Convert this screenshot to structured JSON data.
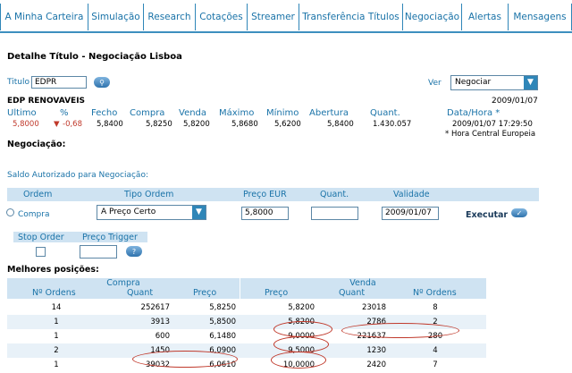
{
  "nav": [
    "A Minha Carteira",
    "Simulação",
    "Research",
    "Cotações",
    "Streamer",
    "Transferência Títulos",
    "Negociação",
    "Alertas",
    "Mensagens"
  ],
  "page_title": "Detalhe Título - Negociação Lisboa",
  "titulo": {
    "label": "Titulo",
    "value": "EDPR"
  },
  "ver": {
    "label": "Ver",
    "value": "Negociar"
  },
  "quote": {
    "name": "EDP RENOVAVEIS",
    "date": "2009/01/07",
    "headers": [
      "Ultimo",
      "%",
      "Fecho",
      "Compra",
      "Venda",
      "Máximo",
      "Mínimo",
      "Abertura",
      "Quant.",
      "Data/Hora *"
    ],
    "values": [
      "5,8000",
      "-0,68",
      "5,8400",
      "5,8250",
      "5,8200",
      "5,8680",
      "5,6200",
      "5,8400",
      "1.430.057",
      "2009/01/07 17:29:50"
    ],
    "note": "* Hora Central Europeia",
    "down_color": "#c0392b"
  },
  "negociacao_label": "Negociação:",
  "saldo_label": "Saldo Autorizado para Negociação:",
  "order": {
    "headers": [
      "Ordem",
      "Tipo Ordem",
      "Preço EUR",
      "Quant.",
      "Validade"
    ],
    "side": "Compra",
    "tipo": "A Preço Certo",
    "preco": "5,8000",
    "quant": "",
    "validade": "2009/01/07",
    "executar": "Executar"
  },
  "stop": {
    "headers": [
      "Stop Order",
      "Preço Trigger"
    ],
    "trigger": ""
  },
  "book": {
    "title": "Melhores posições:",
    "group_compra": "Compra",
    "group_venda": "Venda",
    "headers": [
      "Nº Ordens",
      "Quant",
      "Preço",
      "Preço",
      "Quant",
      "Nº Ordens"
    ],
    "rows": [
      [
        "14",
        "252617",
        "5,8250",
        "5,8200",
        "23018",
        "8"
      ],
      [
        "1",
        "3913",
        "5,8500",
        "5,8200",
        "2786",
        "2"
      ],
      [
        "1",
        "600",
        "6,1480",
        "9,0000",
        "221637",
        "280"
      ],
      [
        "2",
        "1450",
        "6,0900",
        "9,5000",
        "1230",
        "4"
      ],
      [
        "1",
        "39032",
        "6,0610",
        "10,0000",
        "2420",
        "7"
      ]
    ]
  }
}
